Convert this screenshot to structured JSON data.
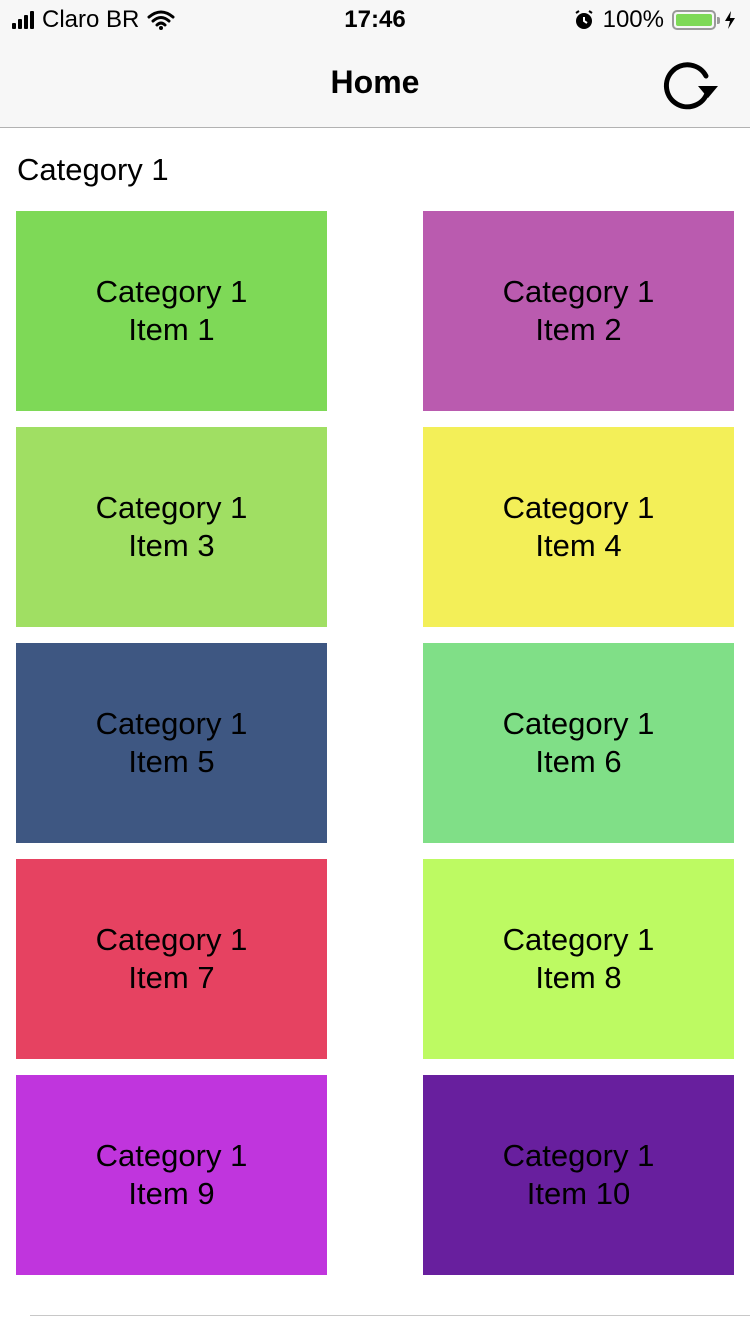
{
  "status_bar": {
    "carrier": "Claro BR",
    "time": "17:46",
    "battery_percent": "100%",
    "battery_level": 1.0,
    "icons": [
      "signal-icon",
      "wifi-icon",
      "alarm-icon",
      "battery-icon",
      "charging-icon"
    ]
  },
  "nav": {
    "title": "Home",
    "refresh_icon": "refresh-icon"
  },
  "section": {
    "title": "Category 1"
  },
  "items": [
    {
      "line1": "Category 1",
      "line2": "Item 1",
      "color": "#7ed957"
    },
    {
      "line1": "Category 1",
      "line2": "Item 2",
      "color": "#ba5baf"
    },
    {
      "line1": "Category 1",
      "line2": "Item 3",
      "color": "#a0df63"
    },
    {
      "line1": "Category 1",
      "line2": "Item 4",
      "color": "#f3ef58"
    },
    {
      "line1": "Category 1",
      "line2": "Item 5",
      "color": "#3e5782"
    },
    {
      "line1": "Category 1",
      "line2": "Item 6",
      "color": "#80df87"
    },
    {
      "line1": "Category 1",
      "line2": "Item 7",
      "color": "#e64261"
    },
    {
      "line1": "Category 1",
      "line2": "Item 8",
      "color": "#bdfa62"
    },
    {
      "line1": "Category 1",
      "line2": "Item 9",
      "color": "#c035dd"
    },
    {
      "line1": "Category 1",
      "line2": "Item 10",
      "color": "#681f9e"
    }
  ]
}
